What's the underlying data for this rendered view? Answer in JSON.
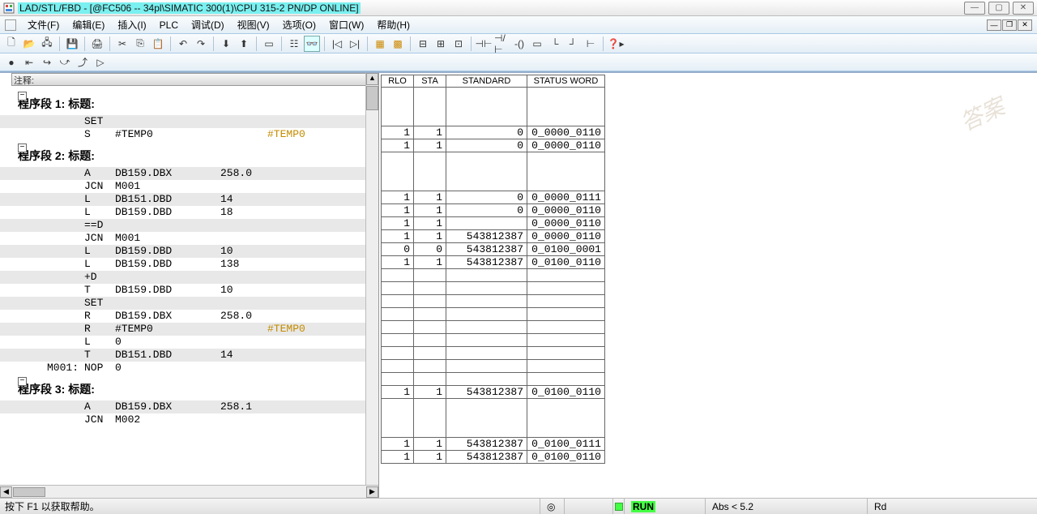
{
  "window": {
    "title": "LAD/STL/FBD  - [@FC506 -- 34pl\\SIMATIC 300(1)\\CPU 315-2 PN/DP  ONLINE]"
  },
  "menu": {
    "file": "文件(F)",
    "edit": "编辑(E)",
    "insert": "插入(I)",
    "plc": "PLC",
    "debug": "调试(D)",
    "view": "视图(V)",
    "options": "选项(O)",
    "window": "窗口(W)",
    "help": "帮助(H)"
  },
  "comment_header": "注释:",
  "segments": [
    {
      "title": "程序段 1: 标题:",
      "rows": [
        {
          "lbl": "",
          "op": "SET",
          "arg": "",
          "num": "",
          "shade": true
        },
        {
          "lbl": "",
          "op": "S",
          "arg": "#TEMP0",
          "num": "",
          "shade": false,
          "ann": "#TEMP0"
        }
      ]
    },
    {
      "title": "程序段 2: 标题:",
      "rows": [
        {
          "lbl": "",
          "op": "A",
          "arg": "DB159.DBX",
          "num": "258.0",
          "shade": true
        },
        {
          "lbl": "",
          "op": "JCN",
          "arg": "M001",
          "num": "",
          "shade": false
        },
        {
          "lbl": "",
          "op": "L",
          "arg": "DB151.DBD",
          "num": "14",
          "shade": true
        },
        {
          "lbl": "",
          "op": "L",
          "arg": "DB159.DBD",
          "num": "18",
          "shade": false
        },
        {
          "lbl": "",
          "op": "==D",
          "arg": "",
          "num": "",
          "shade": true
        },
        {
          "lbl": "",
          "op": "JCN",
          "arg": "M001",
          "num": "",
          "shade": false
        },
        {
          "lbl": "",
          "op": "L",
          "arg": "DB159.DBD",
          "num": "10",
          "shade": true
        },
        {
          "lbl": "",
          "op": "L",
          "arg": "DB159.DBD",
          "num": "138",
          "shade": false
        },
        {
          "lbl": "",
          "op": "+D",
          "arg": "",
          "num": "",
          "shade": true
        },
        {
          "lbl": "",
          "op": "T",
          "arg": "DB159.DBD",
          "num": "10",
          "shade": false
        },
        {
          "lbl": "",
          "op": "SET",
          "arg": "",
          "num": "",
          "shade": true
        },
        {
          "lbl": "",
          "op": "R",
          "arg": "DB159.DBX",
          "num": "258.0",
          "shade": false
        },
        {
          "lbl": "",
          "op": "R",
          "arg": "#TEMP0",
          "num": "",
          "shade": true,
          "ann": "#TEMP0"
        },
        {
          "lbl": "",
          "op": "L",
          "arg": "0",
          "num": "",
          "shade": false
        },
        {
          "lbl": "",
          "op": "T",
          "arg": "DB151.DBD",
          "num": "14",
          "shade": true
        },
        {
          "lbl": "M001:",
          "op": "NOP",
          "arg": "0",
          "num": "",
          "shade": false
        }
      ]
    },
    {
      "title": "程序段 3: 标题:",
      "rows": [
        {
          "lbl": "",
          "op": "A",
          "arg": "DB159.DBX",
          "num": "258.1",
          "shade": true
        },
        {
          "lbl": "",
          "op": "JCN",
          "arg": "M002",
          "num": "",
          "shade": false
        }
      ]
    }
  ],
  "status_header": {
    "rlo": "RLO",
    "sta": "STA",
    "standard": "STANDARD",
    "status_word": "STATUS WORD"
  },
  "status_blocks": [
    {
      "spacer_before": 3,
      "rows": [
        {
          "rlo": "1",
          "sta": "1",
          "std": "0",
          "sw": "0_0000_0110"
        },
        {
          "rlo": "1",
          "sta": "1",
          "std": "0",
          "sw": "0_0000_0110"
        }
      ]
    },
    {
      "spacer_before": 3,
      "rows": [
        {
          "rlo": "1",
          "sta": "1",
          "std": "0",
          "sw": "0_0000_0111"
        },
        {
          "rlo": "1",
          "sta": "1",
          "std": "0",
          "sw": "0_0000_0110"
        },
        {
          "rlo": "1",
          "sta": "1",
          "std": "",
          "sw": "0_0000_0110"
        },
        {
          "rlo": "1",
          "sta": "1",
          "std": "543812387",
          "sw": "0_0000_0110"
        },
        {
          "rlo": "0",
          "sta": "0",
          "std": "543812387",
          "sw": "0_0100_0001"
        },
        {
          "rlo": "1",
          "sta": "1",
          "std": "543812387",
          "sw": "0_0100_0110"
        },
        {
          "rlo": "",
          "sta": "",
          "std": "",
          "sw": ""
        },
        {
          "rlo": "",
          "sta": "",
          "std": "",
          "sw": ""
        },
        {
          "rlo": "",
          "sta": "",
          "std": "",
          "sw": ""
        },
        {
          "rlo": "",
          "sta": "",
          "std": "",
          "sw": ""
        },
        {
          "rlo": "",
          "sta": "",
          "std": "",
          "sw": ""
        },
        {
          "rlo": "",
          "sta": "",
          "std": "",
          "sw": ""
        },
        {
          "rlo": "",
          "sta": "",
          "std": "",
          "sw": ""
        },
        {
          "rlo": "",
          "sta": "",
          "std": "",
          "sw": ""
        },
        {
          "rlo": "",
          "sta": "",
          "std": "",
          "sw": ""
        },
        {
          "rlo": "1",
          "sta": "1",
          "std": "543812387",
          "sw": "0_0100_0110"
        }
      ]
    },
    {
      "spacer_before": 3,
      "rows": [
        {
          "rlo": "1",
          "sta": "1",
          "std": "543812387",
          "sw": "0_0100_0111"
        },
        {
          "rlo": "1",
          "sta": "1",
          "std": "543812387",
          "sw": "0_0100_0110"
        }
      ]
    }
  ],
  "statusbar": {
    "help": "按下 F1 以获取帮助。",
    "run": "RUN",
    "abs": "Abs < 5.2",
    "rd": "Rd"
  },
  "watermark": "答案"
}
